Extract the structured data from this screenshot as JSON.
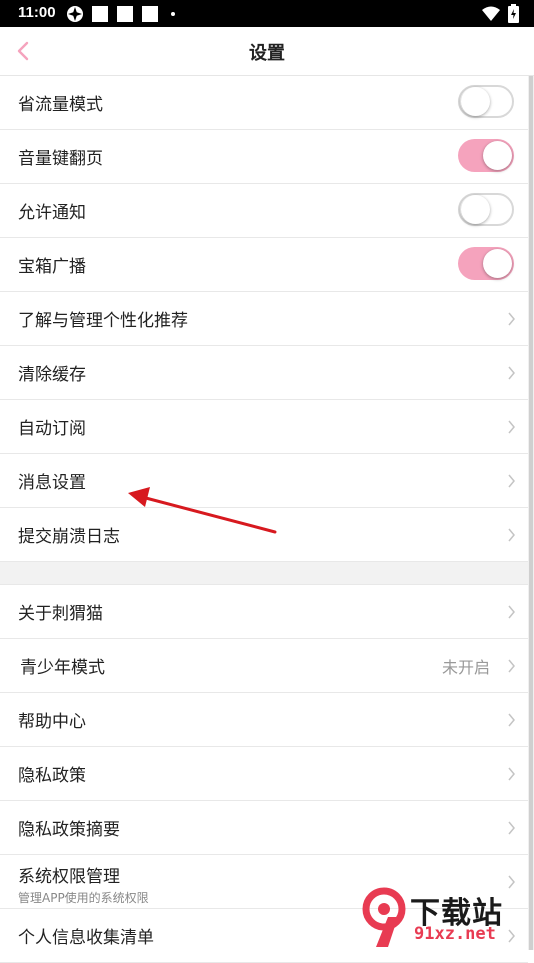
{
  "status_bar": {
    "time": "11:00",
    "icons": [
      "app-icon",
      "notification-square",
      "notification-square",
      "notification-square",
      "more-dot",
      "wifi-icon",
      "battery-charging-icon"
    ]
  },
  "header": {
    "back_icon": "chevron-left-icon",
    "title": "设置"
  },
  "toggle_rows": [
    {
      "label": "省流量模式",
      "on": false
    },
    {
      "label": "音量键翻页",
      "on": true
    },
    {
      "label": "允许通知",
      "on": false
    },
    {
      "label": "宝箱广播",
      "on": true
    }
  ],
  "nav_rows_1": [
    {
      "label": "了解与管理个性化推荐"
    },
    {
      "label": "清除缓存"
    },
    {
      "label": "自动订阅"
    },
    {
      "label": "消息设置"
    },
    {
      "label": "提交崩溃日志"
    }
  ],
  "nav_rows_2": [
    {
      "label": "关于刺猬猫"
    },
    {
      "label": "青少年模式",
      "value": "未开启"
    },
    {
      "label": "帮助中心"
    },
    {
      "label": "隐私政策"
    },
    {
      "label": "隐私政策摘要"
    },
    {
      "label": "系统权限管理",
      "sub": "管理APP使用的系统权限"
    },
    {
      "label": "个人信息收集清单"
    }
  ],
  "colors": {
    "accent": "#f5a3bd",
    "arrow": "#d7191f",
    "back_icon": "#f5a3bd"
  },
  "watermark": {
    "line1": "下载站",
    "line2": "91xz.net"
  }
}
